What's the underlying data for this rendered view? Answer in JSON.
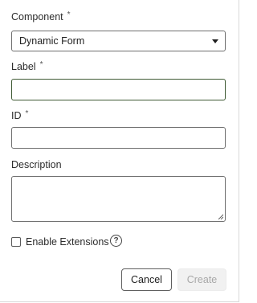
{
  "form": {
    "component": {
      "label": "Component",
      "required_marker": "*",
      "selected_value": "Dynamic Form"
    },
    "label_field": {
      "label": "Label",
      "required_marker": "*",
      "value": ""
    },
    "id_field": {
      "label": "ID",
      "required_marker": "*",
      "value": ""
    },
    "description_field": {
      "label": "Description",
      "value": ""
    },
    "enable_extensions": {
      "label": "Enable Extensions",
      "checked": false,
      "help_glyph": "?"
    }
  },
  "actions": {
    "cancel_label": "Cancel",
    "create_label": "Create"
  },
  "colors": {
    "focused_border": "#3f5a34",
    "disabled_button_bg": "#f1f1f1",
    "disabled_button_text": "#a8a8a8"
  }
}
